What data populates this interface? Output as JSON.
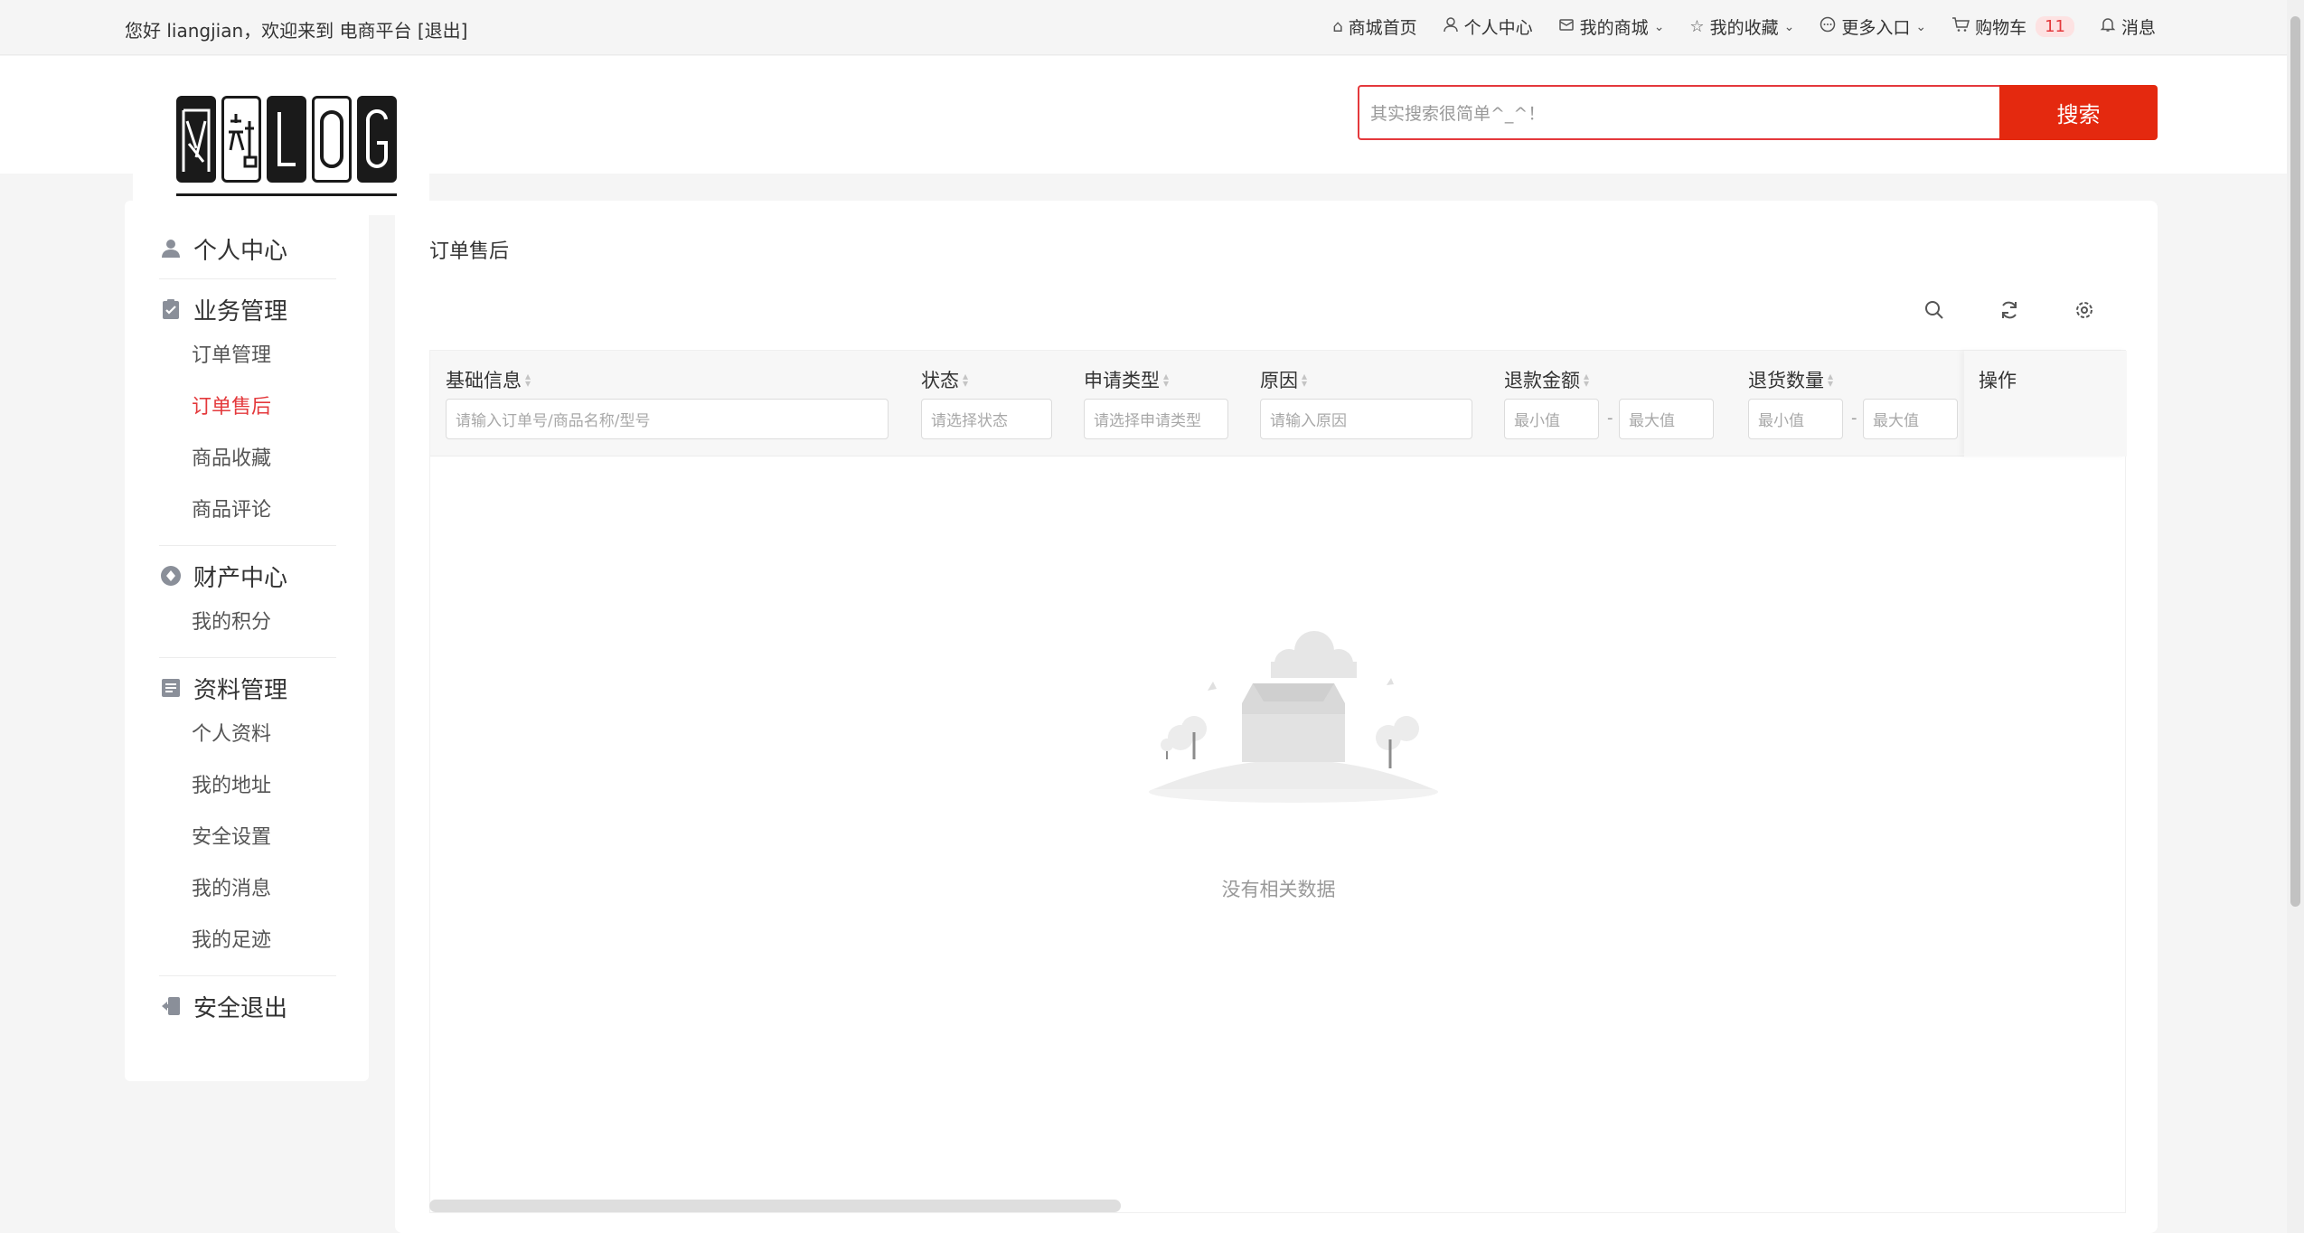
{
  "topbar": {
    "greeting": "您好 liangjian，欢迎来到 电商平台 [退出]",
    "nav": [
      {
        "icon": "home-icon",
        "label": "商城首页"
      },
      {
        "icon": "user-icon",
        "label": "个人中心"
      },
      {
        "icon": "shop-icon",
        "label": "我的商城"
      },
      {
        "icon": "star-icon",
        "label": "我的收藏"
      },
      {
        "icon": "more-icon",
        "label": "更多入口"
      },
      {
        "icon": "cart-icon",
        "label": "购物车",
        "badge": "11"
      },
      {
        "icon": "bell-icon",
        "label": "消息"
      }
    ]
  },
  "search": {
    "placeholder": "其实搜索很简单^_^！",
    "button_label": "搜索"
  },
  "sidebar": {
    "sections": [
      {
        "icon": "user-icon",
        "title": "个人中心",
        "items": []
      },
      {
        "icon": "clipboard-icon",
        "title": "业务管理",
        "items": [
          "订单管理",
          "订单售后",
          "商品收藏",
          "商品评论"
        ]
      },
      {
        "icon": "wallet-icon",
        "title": "财产中心",
        "items": [
          "我的积分"
        ]
      },
      {
        "icon": "profile-icon",
        "title": "资料管理",
        "items": [
          "个人资料",
          "我的地址",
          "安全设置",
          "我的消息",
          "我的足迹"
        ]
      },
      {
        "icon": "logout-icon",
        "title": "安全退出",
        "items": []
      }
    ],
    "active_item": "订单售后"
  },
  "main": {
    "title": "订单售后",
    "tools": [
      "search-icon",
      "refresh-icon",
      "settings-icon"
    ],
    "columns": [
      {
        "label": "基础信息",
        "placeholder": "请输入订单号/商品名称/型号"
      },
      {
        "label": "状态",
        "placeholder": "请选择状态"
      },
      {
        "label": "申请类型",
        "placeholder": "请选择申请类型"
      },
      {
        "label": "原因",
        "placeholder": "请输入原因"
      },
      {
        "label": "退款金额",
        "min_placeholder": "最小值",
        "max_placeholder": "最大值"
      },
      {
        "label": "退货数量",
        "min_placeholder": "最小值",
        "max_placeholder": "最大值"
      }
    ],
    "op_label": "操作",
    "range_separator": "-",
    "empty_text": "没有相关数据"
  }
}
